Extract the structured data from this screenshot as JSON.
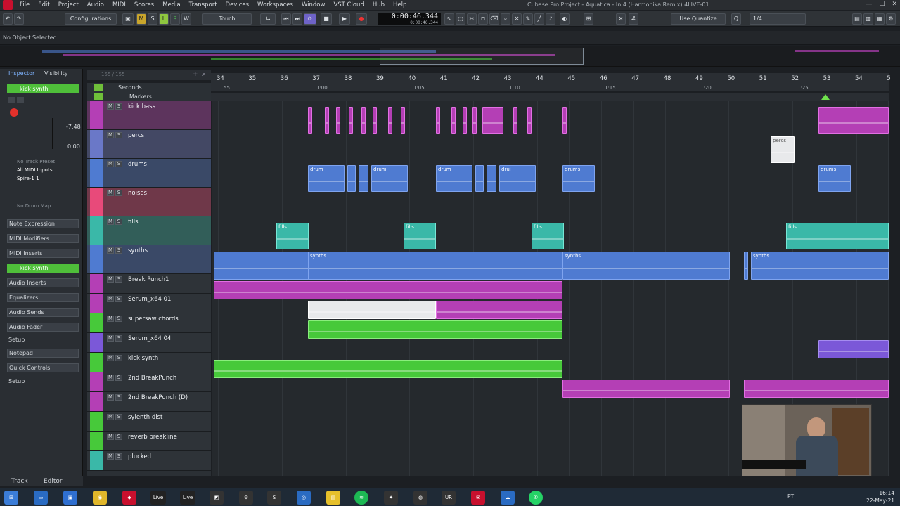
{
  "menubar": {
    "items": [
      "File",
      "Edit",
      "Project",
      "Audio",
      "MIDI",
      "Scores",
      "Media",
      "Transport",
      "Devices",
      "Workspaces",
      "Window",
      "VST Cloud",
      "Hub",
      "Help"
    ],
    "title": "Cubase Pro Project - Aquatica - In 4 (Harmonika Remix) 4LIVE-01"
  },
  "toolbar": {
    "configurations": "Configurations",
    "mode": "Touch",
    "time_main": "0:00:46.344",
    "time_sub": "0:00:46.344",
    "quantize": "Use Quantize",
    "quantize_value": "1/4"
  },
  "infobar": {
    "status": "No Object Selected"
  },
  "inspector": {
    "tabs": [
      "Inspector",
      "Visibility"
    ],
    "track_name": "kick synth",
    "volume": "-7.48",
    "pan": "0.00",
    "track_preset": "No Track Preset",
    "input": "All MIDI Inputs",
    "output": "Spire-1 1",
    "drum_map": "No Drum Map",
    "sections": [
      "Note Expression",
      "MIDI Modifiers",
      "MIDI Inserts",
      "kick synth",
      "Audio Inserts",
      "Equalizers",
      "Audio Sends",
      "Audio Fader",
      "Setup",
      "Notepad",
      "Quick Controls",
      "Setup"
    ],
    "bottom_tabs": [
      "Track",
      "Editor"
    ]
  },
  "ruler": {
    "label": "Seconds",
    "markers": "Markers",
    "bars": [
      "34",
      "35",
      "36",
      "37",
      "38",
      "39",
      "40",
      "41",
      "42",
      "43",
      "44",
      "45",
      "46",
      "47",
      "48",
      "49",
      "50",
      "51",
      "52",
      "53",
      "54",
      "5"
    ],
    "times": [
      "55",
      "1:00",
      "1:05",
      "1:10",
      "1:15",
      "1:20",
      "1:25"
    ],
    "range": "155 / 155"
  },
  "tracks": [
    {
      "name": "kick bass",
      "color": "#b43fb5"
    },
    {
      "name": "percs",
      "color": "#6a78c8"
    },
    {
      "name": "drums",
      "color": "#4f7bd1"
    },
    {
      "name": "noises",
      "color": "#e84a7a"
    },
    {
      "name": "fills",
      "color": "#3ab8a8"
    },
    {
      "name": "synths",
      "color": "#4f7bd1"
    },
    {
      "name": "Break Punch1",
      "color": "#b43fb5"
    },
    {
      "name": "Serum_x64 01",
      "color": "#b43fb5"
    },
    {
      "name": "supersaw chords",
      "color": "#47c93a"
    },
    {
      "name": "Serum_x64 04",
      "color": "#7b58d8"
    },
    {
      "name": "kick synth",
      "color": "#47c93a"
    },
    {
      "name": "2nd BreakPunch",
      "color": "#b43fb5"
    },
    {
      "name": "2nd BreakPunch (D)",
      "color": "#b43fb5"
    },
    {
      "name": "sylenth dist",
      "color": "#47c93a"
    },
    {
      "name": "reverb breakline",
      "color": "#47c93a"
    },
    {
      "name": "plucked",
      "color": "#3ab8a8"
    }
  ],
  "clip_labels": {
    "drums": "drums",
    "drum_short": "drum",
    "drui": "drui",
    "fills": "fills",
    "synths": "synths",
    "percs": "percs"
  },
  "taskbar": {
    "live1": "Live",
    "live2": "Live",
    "clock_time": "16:14",
    "clock_date": "22-May-21",
    "lang": "PT"
  }
}
